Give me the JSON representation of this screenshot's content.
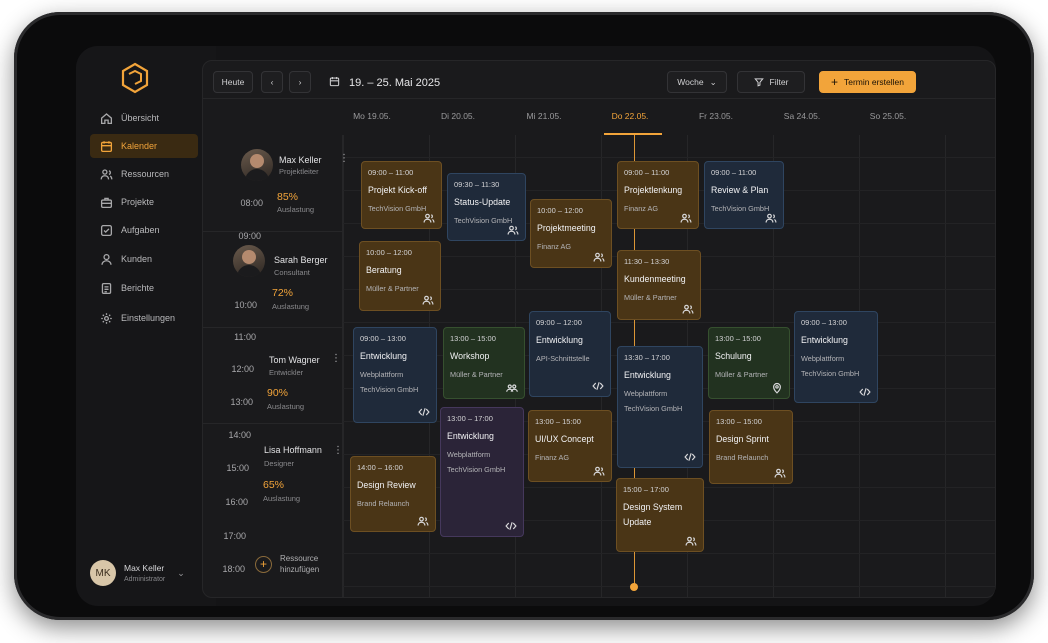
{
  "sidebar": {
    "items": [
      {
        "label": "Übersicht",
        "icon": "home-icon"
      },
      {
        "label": "Kalender",
        "icon": "calendar-icon"
      },
      {
        "label": "Ressourcen",
        "icon": "users-icon"
      },
      {
        "label": "Projekte",
        "icon": "briefcase-icon"
      },
      {
        "label": "Aufgaben",
        "icon": "checkbox-icon"
      },
      {
        "label": "Kunden",
        "icon": "user-icon"
      },
      {
        "label": "Berichte",
        "icon": "report-icon"
      },
      {
        "label": "Einstellungen",
        "icon": "gear-icon"
      }
    ],
    "user": {
      "initials": "MK",
      "name": "Max Keller",
      "role": "Administrator"
    }
  },
  "toolbar": {
    "today_label": "Heute",
    "date_range": "19. – 25. Mai 2025",
    "view_label": "Woche",
    "filter_label": "Filter",
    "create_label": "Termin erstellen"
  },
  "days": [
    "Mo 19.05.",
    "Di 20.05.",
    "Mi 21.05.",
    "Do 22.05.",
    "Fr 23.05.",
    "Sa 24.05.",
    "So 25.05."
  ],
  "times": [
    "08:00",
    "09:00",
    "10:00",
    "11:00",
    "12:00",
    "13:00",
    "14:00",
    "15:00",
    "16:00",
    "17:00",
    "18:00"
  ],
  "resources": [
    {
      "name": "Max Keller",
      "role": "Projektleiter",
      "utilization": "85%",
      "util_label": "Auslastung"
    },
    {
      "name": "Sarah Berger",
      "role": "Consultant",
      "utilization": "72%",
      "util_label": "Auslastung"
    },
    {
      "name": "Tom Wagner",
      "role": "Entwickler",
      "utilization": "90%",
      "util_label": "Auslastung"
    },
    {
      "name": "Lisa Hoffmann",
      "role": "Designer",
      "utilization": "65%",
      "util_label": "Auslastung"
    }
  ],
  "add_resource": "Ressource hinzufügen",
  "events": [
    {
      "time": "09:00 – 11:00",
      "title": "Projekt Kick-off",
      "sub": "TechVision GmbH",
      "color": "amber",
      "icon": "people-icon"
    },
    {
      "time": "09:30 – 11:30",
      "title": "Status-Update",
      "sub": "TechVision GmbH",
      "color": "blue",
      "icon": "people-icon"
    },
    {
      "time": "10:00 – 12:00",
      "title": "Projektmeeting",
      "sub": "Finanz AG",
      "color": "amber",
      "icon": "people-icon"
    },
    {
      "time": "09:00 – 11:00",
      "title": "Projektlenkung",
      "sub": "Finanz AG",
      "color": "amber",
      "icon": "people-icon"
    },
    {
      "time": "09:00 – 11:00",
      "title": "Review & Plan",
      "sub": "TechVision GmbH",
      "color": "blue",
      "icon": "people-icon"
    },
    {
      "time": "10:00 – 12:00",
      "title": "Beratung",
      "sub": "Müller & Partner",
      "color": "amber",
      "icon": "people-icon"
    },
    {
      "time": "11:30 – 13:30",
      "title": "Kundenmeeting",
      "sub": "Müller & Partner",
      "color": "amber",
      "icon": "people-icon"
    },
    {
      "time": "09:00 – 13:00",
      "title": "Entwicklung",
      "sub": "Webplattform",
      "sub2": "TechVision GmbH",
      "color": "blue",
      "icon": "code-icon"
    },
    {
      "time": "13:00 – 15:00",
      "title": "Workshop",
      "sub": "Müller & Partner",
      "color": "green",
      "icon": "group-icon"
    },
    {
      "time": "09:00 – 12:00",
      "title": "Entwicklung",
      "sub": "API-Schnittstelle",
      "color": "blue",
      "icon": "code-icon"
    },
    {
      "time": "13:30 – 17:00",
      "title": "Entwicklung",
      "sub": "Webplattform",
      "sub2": "TechVision GmbH",
      "color": "blue",
      "icon": "code-icon"
    },
    {
      "time": "13:00 – 15:00",
      "title": "Schulung",
      "sub": "Müller & Partner",
      "color": "green",
      "icon": "location-icon"
    },
    {
      "time": "09:00 – 13:00",
      "title": "Entwicklung",
      "sub": "Webplattform",
      "sub2": "TechVision GmbH",
      "color": "blue",
      "icon": "code-icon"
    },
    {
      "time": "13:00 – 17:00",
      "title": "Entwicklung",
      "sub": "Webplattform",
      "sub2": "TechVision GmbH",
      "color": "purple",
      "icon": "code-icon"
    },
    {
      "time": "13:00 – 15:00",
      "title": "UI/UX Concept",
      "sub": "Finanz AG",
      "color": "amber",
      "icon": "people-icon"
    },
    {
      "time": "13:00 – 15:00",
      "title": "Design Sprint",
      "sub": "Brand Relaunch",
      "color": "amber",
      "icon": "people-icon"
    },
    {
      "time": "14:00 – 16:00",
      "title": "Design Review",
      "sub": "Brand Relaunch",
      "color": "amber",
      "icon": "people-icon"
    },
    {
      "time": "15:00 – 17:00",
      "title": "Design System Update",
      "sub": "",
      "color": "amber",
      "icon": "people-icon"
    }
  ]
}
